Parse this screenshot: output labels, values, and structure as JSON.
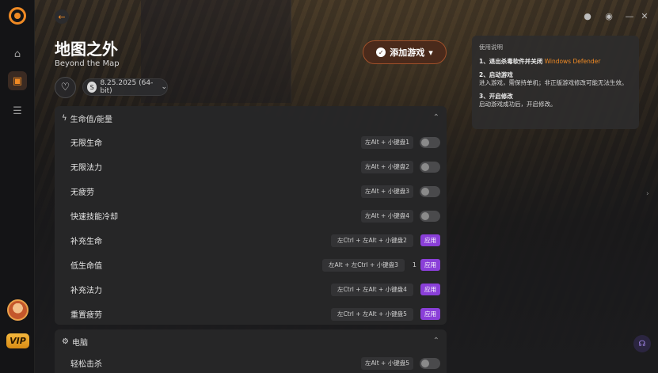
{
  "game": {
    "title": "地图之外",
    "subtitle": "Beyond the Map",
    "version": "8.25.2025 (64-bit)"
  },
  "actions": {
    "add_game": "添加游戏"
  },
  "instructions": {
    "heading": "使用说明",
    "step1_title": "1、退出杀毒软件并关闭",
    "step1_highlight": "Windows Defender",
    "step2_title": "2、启动游戏",
    "step2_text": "进入游戏，需保持单机；非正版游戏修改可能无法生效。",
    "step3_title": "3、开启修改",
    "step3_text": "启动游戏成功后，开启修改。"
  },
  "sections": [
    {
      "title": "生命值/能量",
      "rows": [
        {
          "label": "无限生命",
          "hotkey": "左Alt + 小键盘1",
          "control": "toggle"
        },
        {
          "label": "无限法力",
          "hotkey": "左Alt + 小键盘2",
          "control": "toggle"
        },
        {
          "label": "无疲劳",
          "hotkey": "左Alt + 小键盘3",
          "control": "toggle"
        },
        {
          "label": "快速技能冷却",
          "hotkey": "左Alt + 小键盘4",
          "control": "toggle"
        },
        {
          "label": "补充生命",
          "hotkey": "左Ctrl + 左Alt + 小键盘2",
          "control": "apply",
          "apply_label": "应用"
        },
        {
          "label": "低生命值",
          "hotkey": "左Alt + 左Ctrl + 小键盘3",
          "control": "apply",
          "value": "1",
          "apply_label": "应用"
        },
        {
          "label": "补充法力",
          "hotkey": "左Ctrl + 左Alt + 小键盘4",
          "control": "apply",
          "apply_label": "应用"
        },
        {
          "label": "重置疲劳",
          "hotkey": "左Ctrl + 左Alt + 小键盘5",
          "control": "apply",
          "apply_label": "应用"
        }
      ]
    },
    {
      "title": "电脑",
      "rows": [
        {
          "label": "轻松击杀",
          "hotkey": "左Alt + 小键盘5",
          "control": "toggle"
        }
      ]
    }
  ],
  "sidebar": {
    "vip_label": "VIP"
  },
  "colors": {
    "accent": "#f08a24",
    "apply": "#8a3fd8"
  }
}
